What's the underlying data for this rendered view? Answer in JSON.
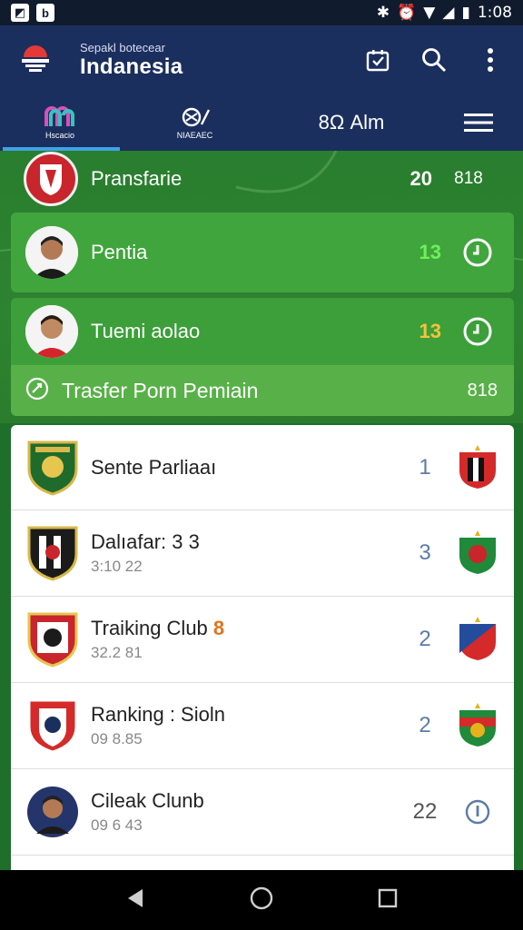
{
  "status_bar": {
    "time": "1:08"
  },
  "app_bar": {
    "subtitle": "Sepakl botecear",
    "title": "Indanesia"
  },
  "tabs": [
    {
      "label": "Hscacio"
    },
    {
      "label": "NIAEAEC"
    },
    {
      "label": "8Ω Alm"
    }
  ],
  "top_rows": [
    {
      "name": "Pransfarie",
      "value": "20",
      "extra": "818"
    },
    {
      "name": "Pentia",
      "value": "13"
    },
    {
      "name": "Tuemi aolao",
      "value": "13"
    },
    {
      "name": "Trasfer Porn Pemiain",
      "value": "818"
    }
  ],
  "list_items": [
    {
      "name": "Sente Parliaaı",
      "sub": "",
      "value": "1"
    },
    {
      "name": "Dalıafar: 3 3",
      "sub": "3:10 22",
      "value": "3"
    },
    {
      "name": "Traiking Club",
      "highlight": "8",
      "sub": "32.2 81",
      "value": "2"
    },
    {
      "name": "Ranking : Sioln",
      "sub": "09 8.85",
      "value": "2"
    },
    {
      "name": "Cileak Clunb",
      "sub": "09 6 43",
      "value": "22"
    }
  ],
  "colors": {
    "app_bar": "#1b2f5e",
    "field_green": "#2c8330",
    "tab_indicator": "#3fa2e8"
  }
}
